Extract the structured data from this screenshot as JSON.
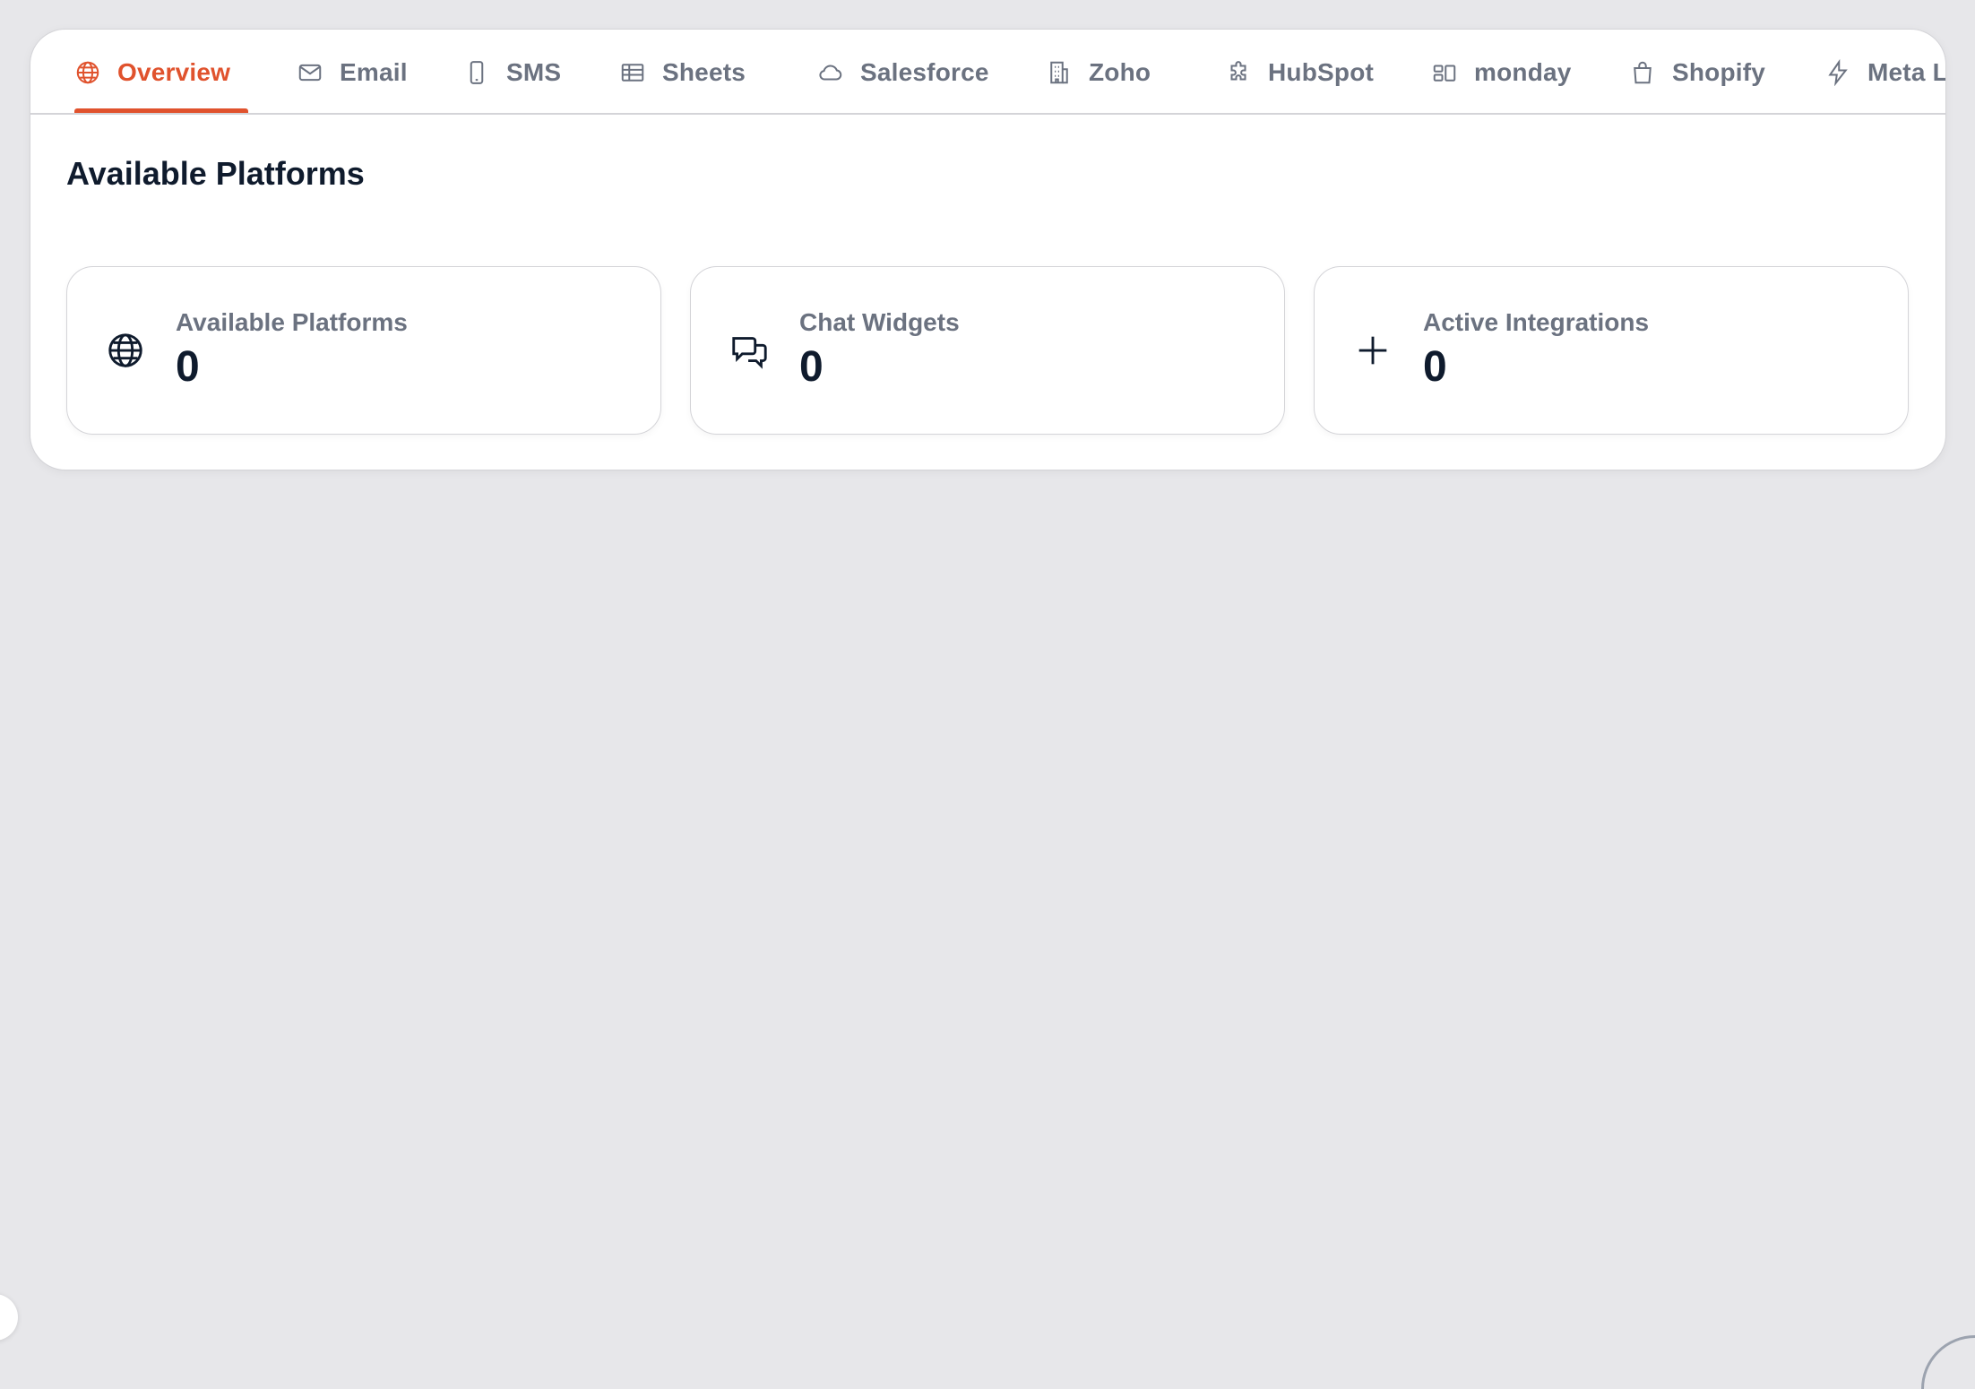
{
  "tabs": [
    {
      "label": "Overview",
      "icon": "globe-icon",
      "active": true
    },
    {
      "label": "Email",
      "icon": "mail-icon",
      "active": false
    },
    {
      "label": "SMS",
      "icon": "phone-icon",
      "active": false
    },
    {
      "label": "Sheets",
      "icon": "table-icon",
      "active": false
    },
    {
      "label": "Salesforce",
      "icon": "cloud-icon",
      "active": false
    },
    {
      "label": "Zoho",
      "icon": "building-icon",
      "active": false
    },
    {
      "label": "HubSpot",
      "icon": "puzzle-icon",
      "active": false
    },
    {
      "label": "monday",
      "icon": "board-icon",
      "active": false
    },
    {
      "label": "Shopify",
      "icon": "shopping-bag-icon",
      "active": false
    },
    {
      "label": "Meta Lea",
      "icon": "lightning-icon",
      "active": false
    }
  ],
  "main": {
    "section_title": "Available Platforms",
    "cards": [
      {
        "label": "Available Platforms",
        "value": "0",
        "icon": "globe-icon"
      },
      {
        "label": "Chat Widgets",
        "value": "0",
        "icon": "chat-bubbles-icon"
      },
      {
        "label": "Active Integrations",
        "value": "0",
        "icon": "plus-icon"
      }
    ]
  },
  "colors": {
    "accent": "#e0522d",
    "text_primary": "#0f1b2d",
    "text_muted": "#6b7280",
    "border": "#d4d4d8",
    "background": "#e7e7ea"
  }
}
